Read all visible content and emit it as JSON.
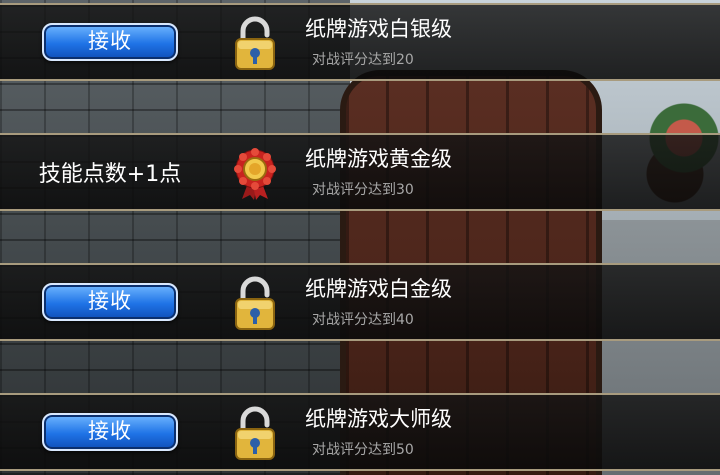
{
  "achievements": [
    {
      "reward": "接收",
      "reward_type": "button",
      "icon": "lock-icon",
      "title": "纸牌游戏白银级",
      "desc": "对战评分达到20"
    },
    {
      "reward": "技能点数+1点",
      "reward_type": "text",
      "icon": "medal-icon",
      "title": "纸牌游戏黄金级",
      "desc": "对战评分达到30"
    },
    {
      "reward": "接收",
      "reward_type": "button",
      "icon": "lock-icon",
      "title": "纸牌游戏白金级",
      "desc": "对战评分达到40"
    },
    {
      "reward": "接收",
      "reward_type": "button",
      "icon": "lock-icon",
      "title": "纸牌游戏大师级",
      "desc": "对战评分达到50"
    }
  ],
  "colors": {
    "button": "#1f73e6",
    "row_border": "#a89b7e",
    "lock": "#e1b53c",
    "medal": "#c8231f"
  }
}
